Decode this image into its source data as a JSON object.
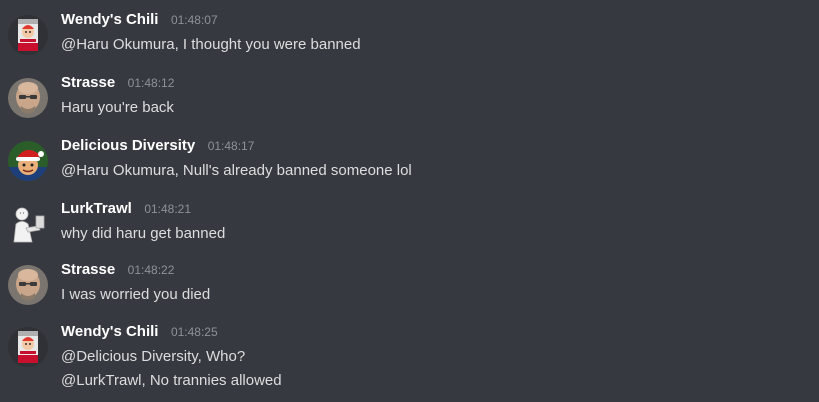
{
  "messages": [
    {
      "author": "Wendy's Chili",
      "time": "01:48:07",
      "avatar_icon": "chili-can-avatar",
      "lines": [
        "@Haru Okumura, I thought you were banned"
      ]
    },
    {
      "author": "Strasse",
      "time": "01:48:12",
      "avatar_icon": "bald-man-avatar",
      "lines": [
        "Haru you're back"
      ]
    },
    {
      "author": "Delicious Diversity",
      "time": "01:48:17",
      "avatar_icon": "santa-hat-avatar",
      "lines": [
        "@Haru Okumura, Null's already banned someone lol"
      ]
    },
    {
      "author": "LurkTrawl",
      "time": "01:48:21",
      "avatar_icon": "sketch-figure-avatar",
      "lines": [
        "why did haru get banned"
      ]
    },
    {
      "author": "Strasse",
      "time": "01:48:22",
      "avatar_icon": "bald-man-avatar",
      "lines": [
        "I was worried you died"
      ]
    },
    {
      "author": "Wendy's Chili",
      "time": "01:48:25",
      "avatar_icon": "chili-can-avatar",
      "lines": [
        "@Delicious Diversity, Who?",
        "@LurkTrawl, No trannies allowed"
      ]
    }
  ],
  "colors": {
    "background": "#36393f",
    "author": "#ffffff",
    "timestamp": "#8e9297",
    "text": "#dcddde"
  }
}
